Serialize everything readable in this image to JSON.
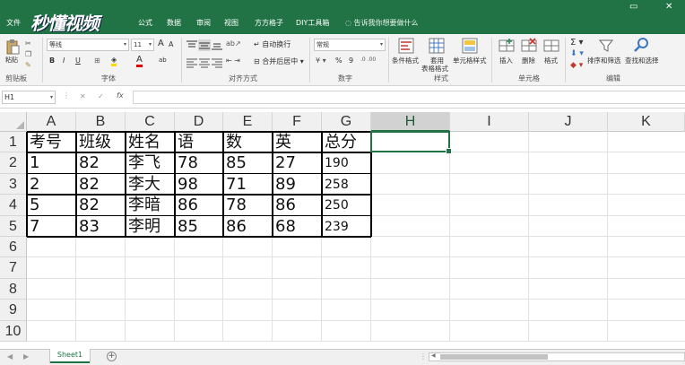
{
  "watermark": "秒懂视频",
  "tabs": [
    "文件",
    "开始",
    "插入",
    "页面布局",
    "公式",
    "数据",
    "审阅",
    "视图",
    "方方格子",
    "DIY工具箱"
  ],
  "tell_me": "告诉我你想要做什么",
  "window_controls": [
    "▭",
    "✕"
  ],
  "ribbon": {
    "clipboard": {
      "label": "剪贴板",
      "paste": "粘贴"
    },
    "font": {
      "label": "字体",
      "name": "等线",
      "size": "11",
      "bold": "B",
      "italic": "I",
      "underline": "U",
      "grow": "A",
      "shrink": "A",
      "color": "A",
      "fill": "ab"
    },
    "alignment": {
      "label": "对齐方式",
      "wrap": "自动换行",
      "merge": "合并后居中"
    },
    "number": {
      "label": "数字",
      "format": "常规",
      "percent": "%",
      "comma": "9"
    },
    "styles": {
      "label": "样式",
      "conditional": "条件格式",
      "as_table_1": "套用",
      "as_table_2": "表格格式",
      "cell_styles": "单元格样式"
    },
    "cells": {
      "label": "单元格",
      "insert": "插入",
      "delete": "删除",
      "format": "格式"
    },
    "editing": {
      "label": "编辑",
      "sort": "排序和筛选",
      "find": "查找和选择"
    }
  },
  "formula_bar": {
    "name_box": "H1",
    "cancel": "✕",
    "enter": "✓",
    "fx": "fx",
    "formula": ""
  },
  "columns": [
    "A",
    "B",
    "C",
    "D",
    "E",
    "F",
    "G",
    "H",
    "I",
    "J",
    "K"
  ],
  "rows": [
    "1",
    "2",
    "3",
    "4",
    "5",
    "6",
    "7",
    "8",
    "9",
    "10"
  ],
  "table": {
    "headers": [
      "考号",
      "班级",
      "姓名",
      "语",
      "数",
      "英",
      "总分"
    ],
    "rows": [
      [
        "1",
        "82",
        "李飞",
        "78",
        "85",
        "27",
        "190"
      ],
      [
        "2",
        "82",
        "李大",
        "98",
        "71",
        "89",
        "258"
      ],
      [
        "5",
        "82",
        "李暗",
        "86",
        "78",
        "86",
        "250"
      ],
      [
        "7",
        "83",
        "李明",
        "85",
        "86",
        "68",
        "239"
      ]
    ]
  },
  "active_cell": "H1",
  "sheets": [
    "Sheet1"
  ],
  "add_sheet": "+",
  "colors": {
    "accent": "#217346",
    "header_bg": "#f0f0f0",
    "grid": "#e1e1e1"
  }
}
